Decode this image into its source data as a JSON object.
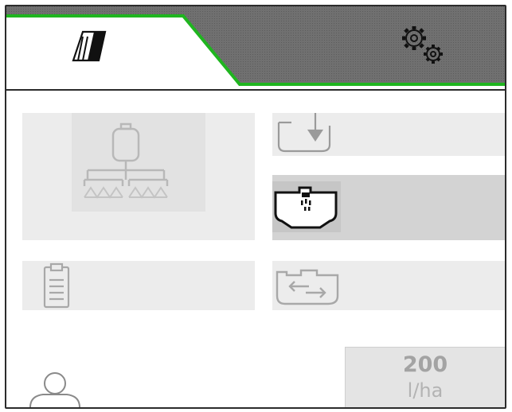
{
  "header": {
    "tabs": [
      {
        "id": "field",
        "icon": "field-tramline-icon",
        "active": true
      },
      {
        "id": "settings",
        "icon": "settings-gears-icon",
        "active": false
      }
    ],
    "accent_color": "#1fb51f",
    "inactive_tab_color": "#6e6e6e"
  },
  "tiles": [
    {
      "id": "sprayer",
      "icon": "sprayer-boom-tank-icon",
      "state": "disabled"
    },
    {
      "id": "fill",
      "icon": "tank-fill-icon",
      "state": "enabled"
    },
    {
      "id": "spray",
      "icon": "tank-spray-icon",
      "state": "selected"
    },
    {
      "id": "documentation",
      "icon": "clipboard-icon",
      "state": "disabled"
    },
    {
      "id": "circulation",
      "icon": "tank-circulation-icon",
      "state": "enabled"
    }
  ],
  "application_rate": {
    "value": "200",
    "unit": "l/ha"
  },
  "user": {
    "icon": "user-icon"
  }
}
